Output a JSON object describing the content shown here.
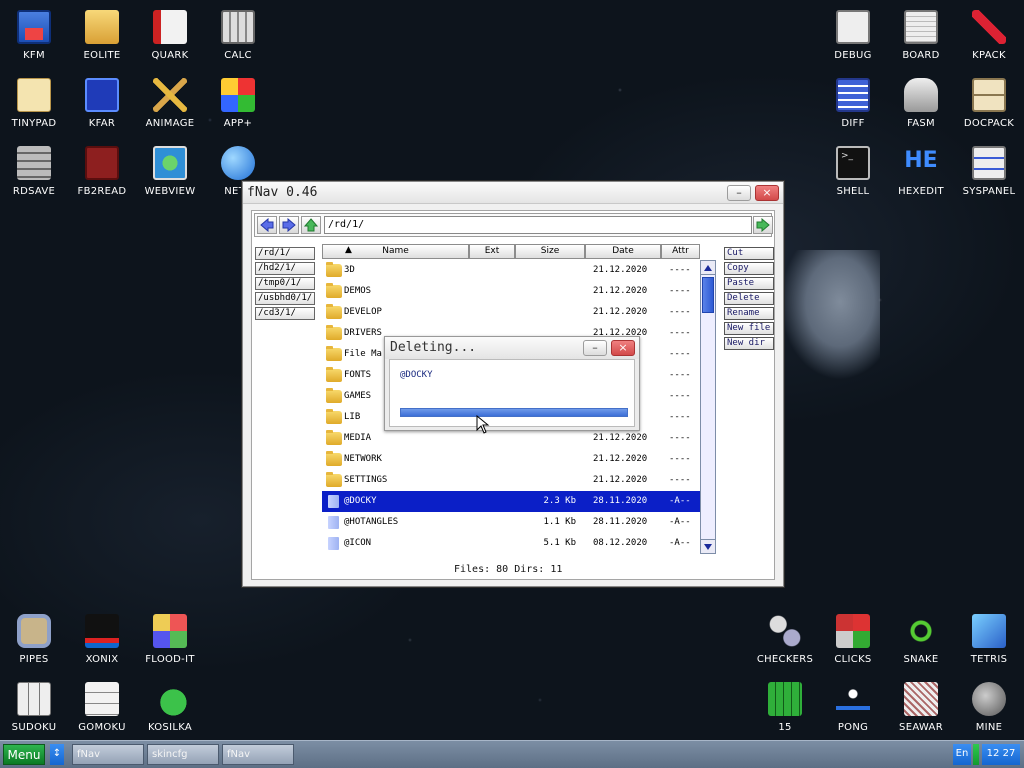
{
  "desktop_icons": {
    "kfm": "KFM",
    "eolite": "EOLITE",
    "quark": "QUARK",
    "calc": "CALC",
    "tinypad": "TINYPAD",
    "kfar": "KFAR",
    "animage": "ANIMAGE",
    "app_plus": "APP+",
    "rdsave": "RDSAVE",
    "fb2read": "FB2READ",
    "webview": "WEBVIEW",
    "nets": "NETS",
    "debug": "DEBUG",
    "board": "BOARD",
    "kpack": "KPACK",
    "diff": "DIFF",
    "fasm": "FASM",
    "docpack": "DOCPACK",
    "shell": "SHELL",
    "hexedit": "HEXEDIT",
    "syspanel": "SYSPANEL",
    "pipes": "PIPES",
    "xonix": "XONIX",
    "flood_it": "FLOOD-IT",
    "sudoku": "SUDOKU",
    "gomoku": "GOMOKU",
    "kosilka": "KOSILKA",
    "checkers": "CHECKERS",
    "clicks": "CLICKS",
    "snake": "SNAKE",
    "tetris": "TETRIS",
    "fifteen": "15",
    "pong": "PONG",
    "seawar": "SEAWAR",
    "mine": "MINE"
  },
  "hexedit_glyph": "HE",
  "fnav": {
    "title": "fNav 0.46",
    "path": "/rd/1/",
    "drives": [
      "/rd/1/",
      "/hd2/1/",
      "/tmp0/1/",
      "/usbhd0/1/",
      "/cd3/1/"
    ],
    "columns": {
      "name": "Name",
      "ext": "Ext",
      "size": "Size",
      "date": "Date",
      "attr": "Attr"
    },
    "actions": [
      "Cut",
      "Copy",
      "Paste",
      "Delete",
      "Rename",
      "New file",
      "New dir"
    ],
    "files": [
      {
        "name": "3D",
        "size": "",
        "date": "21.12.2020",
        "attr": "----",
        "type": "folder"
      },
      {
        "name": "DEMOS",
        "size": "",
        "date": "21.12.2020",
        "attr": "----",
        "type": "folder"
      },
      {
        "name": "DEVELOP",
        "size": "",
        "date": "21.12.2020",
        "attr": "----",
        "type": "folder"
      },
      {
        "name": "DRIVERS",
        "size": "",
        "date": "21.12.2020",
        "attr": "----",
        "type": "folder"
      },
      {
        "name": "File Ma",
        "size": "",
        "date": "",
        "attr": "----",
        "type": "folder"
      },
      {
        "name": "FONTS",
        "size": "",
        "date": "",
        "attr": "----",
        "type": "folder"
      },
      {
        "name": "GAMES",
        "size": "",
        "date": "",
        "attr": "----",
        "type": "folder"
      },
      {
        "name": "LIB",
        "size": "",
        "date": "",
        "attr": "----",
        "type": "folder"
      },
      {
        "name": "MEDIA",
        "size": "",
        "date": "21.12.2020",
        "attr": "----",
        "type": "folder"
      },
      {
        "name": "NETWORK",
        "size": "",
        "date": "21.12.2020",
        "attr": "----",
        "type": "folder"
      },
      {
        "name": "SETTINGS",
        "size": "",
        "date": "21.12.2020",
        "attr": "----",
        "type": "folder"
      },
      {
        "name": "@DOCKY",
        "size": "2.3 Kb",
        "date": "28.11.2020",
        "attr": "-A--",
        "type": "file",
        "selected": true
      },
      {
        "name": "@HOTANGLES",
        "size": "1.1 Kb",
        "date": "28.11.2020",
        "attr": "-A--",
        "type": "file"
      },
      {
        "name": "@ICON",
        "size": "5.1 Kb",
        "date": "08.12.2020",
        "attr": "-A--",
        "type": "file"
      }
    ],
    "status": "Files: 80    Dirs: 11"
  },
  "dialog": {
    "title": "Deleting...",
    "filename": "@DOCKY",
    "progress": 1.0
  },
  "taskbar": {
    "menu": "Menu",
    "switch_glyph": "↕",
    "tasks": [
      "fNav",
      "skincfg",
      "fNav"
    ],
    "lang": "En",
    "clock": "12 27"
  },
  "colors": {
    "selection": "#0b1fc7",
    "menu": "#1a9a3a",
    "accent": "#2e5ad4"
  }
}
